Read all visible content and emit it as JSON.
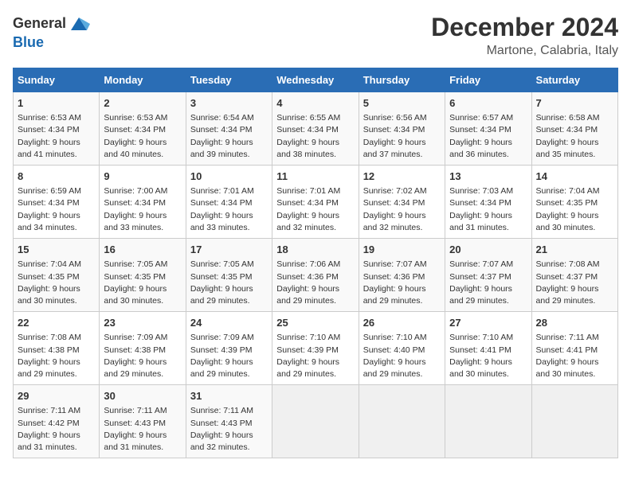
{
  "logo": {
    "general": "General",
    "blue": "Blue"
  },
  "title": "December 2024",
  "subtitle": "Martone, Calabria, Italy",
  "days_header": [
    "Sunday",
    "Monday",
    "Tuesday",
    "Wednesday",
    "Thursday",
    "Friday",
    "Saturday"
  ],
  "weeks": [
    [
      {
        "day": "1",
        "sunrise": "6:53 AM",
        "sunset": "4:34 PM",
        "daylight": "9 hours and 41 minutes."
      },
      {
        "day": "2",
        "sunrise": "6:53 AM",
        "sunset": "4:34 PM",
        "daylight": "9 hours and 40 minutes."
      },
      {
        "day": "3",
        "sunrise": "6:54 AM",
        "sunset": "4:34 PM",
        "daylight": "9 hours and 39 minutes."
      },
      {
        "day": "4",
        "sunrise": "6:55 AM",
        "sunset": "4:34 PM",
        "daylight": "9 hours and 38 minutes."
      },
      {
        "day": "5",
        "sunrise": "6:56 AM",
        "sunset": "4:34 PM",
        "daylight": "9 hours and 37 minutes."
      },
      {
        "day": "6",
        "sunrise": "6:57 AM",
        "sunset": "4:34 PM",
        "daylight": "9 hours and 36 minutes."
      },
      {
        "day": "7",
        "sunrise": "6:58 AM",
        "sunset": "4:34 PM",
        "daylight": "9 hours and 35 minutes."
      }
    ],
    [
      {
        "day": "8",
        "sunrise": "6:59 AM",
        "sunset": "4:34 PM",
        "daylight": "9 hours and 34 minutes."
      },
      {
        "day": "9",
        "sunrise": "7:00 AM",
        "sunset": "4:34 PM",
        "daylight": "9 hours and 33 minutes."
      },
      {
        "day": "10",
        "sunrise": "7:01 AM",
        "sunset": "4:34 PM",
        "daylight": "9 hours and 33 minutes."
      },
      {
        "day": "11",
        "sunrise": "7:01 AM",
        "sunset": "4:34 PM",
        "daylight": "9 hours and 32 minutes."
      },
      {
        "day": "12",
        "sunrise": "7:02 AM",
        "sunset": "4:34 PM",
        "daylight": "9 hours and 32 minutes."
      },
      {
        "day": "13",
        "sunrise": "7:03 AM",
        "sunset": "4:34 PM",
        "daylight": "9 hours and 31 minutes."
      },
      {
        "day": "14",
        "sunrise": "7:04 AM",
        "sunset": "4:35 PM",
        "daylight": "9 hours and 30 minutes."
      }
    ],
    [
      {
        "day": "15",
        "sunrise": "7:04 AM",
        "sunset": "4:35 PM",
        "daylight": "9 hours and 30 minutes."
      },
      {
        "day": "16",
        "sunrise": "7:05 AM",
        "sunset": "4:35 PM",
        "daylight": "9 hours and 30 minutes."
      },
      {
        "day": "17",
        "sunrise": "7:05 AM",
        "sunset": "4:35 PM",
        "daylight": "9 hours and 29 minutes."
      },
      {
        "day": "18",
        "sunrise": "7:06 AM",
        "sunset": "4:36 PM",
        "daylight": "9 hours and 29 minutes."
      },
      {
        "day": "19",
        "sunrise": "7:07 AM",
        "sunset": "4:36 PM",
        "daylight": "9 hours and 29 minutes."
      },
      {
        "day": "20",
        "sunrise": "7:07 AM",
        "sunset": "4:37 PM",
        "daylight": "9 hours and 29 minutes."
      },
      {
        "day": "21",
        "sunrise": "7:08 AM",
        "sunset": "4:37 PM",
        "daylight": "9 hours and 29 minutes."
      }
    ],
    [
      {
        "day": "22",
        "sunrise": "7:08 AM",
        "sunset": "4:38 PM",
        "daylight": "9 hours and 29 minutes."
      },
      {
        "day": "23",
        "sunrise": "7:09 AM",
        "sunset": "4:38 PM",
        "daylight": "9 hours and 29 minutes."
      },
      {
        "day": "24",
        "sunrise": "7:09 AM",
        "sunset": "4:39 PM",
        "daylight": "9 hours and 29 minutes."
      },
      {
        "day": "25",
        "sunrise": "7:10 AM",
        "sunset": "4:39 PM",
        "daylight": "9 hours and 29 minutes."
      },
      {
        "day": "26",
        "sunrise": "7:10 AM",
        "sunset": "4:40 PM",
        "daylight": "9 hours and 29 minutes."
      },
      {
        "day": "27",
        "sunrise": "7:10 AM",
        "sunset": "4:41 PM",
        "daylight": "9 hours and 30 minutes."
      },
      {
        "day": "28",
        "sunrise": "7:11 AM",
        "sunset": "4:41 PM",
        "daylight": "9 hours and 30 minutes."
      }
    ],
    [
      {
        "day": "29",
        "sunrise": "7:11 AM",
        "sunset": "4:42 PM",
        "daylight": "9 hours and 31 minutes."
      },
      {
        "day": "30",
        "sunrise": "7:11 AM",
        "sunset": "4:43 PM",
        "daylight": "9 hours and 31 minutes."
      },
      {
        "day": "31",
        "sunrise": "7:11 AM",
        "sunset": "4:43 PM",
        "daylight": "9 hours and 32 minutes."
      },
      null,
      null,
      null,
      null
    ]
  ]
}
